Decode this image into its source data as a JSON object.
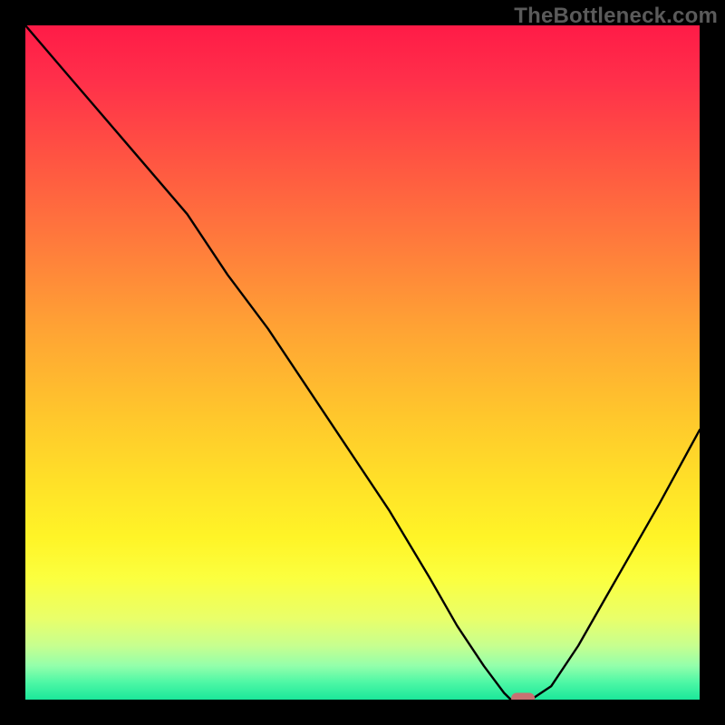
{
  "watermark": "TheBottleneck.com",
  "chart_data": {
    "type": "line",
    "title": "",
    "xlabel": "",
    "ylabel": "",
    "xlim": [
      0,
      100
    ],
    "ylim": [
      0,
      100
    ],
    "grid": false,
    "legend": false,
    "series": [
      {
        "name": "bottleneck-curve",
        "x": [
          0,
          6,
          12,
          18,
          24,
          30,
          36,
          42,
          48,
          54,
          60,
          64,
          68,
          71,
          72,
          75,
          78,
          82,
          86,
          90,
          94,
          100
        ],
        "y": [
          100,
          93,
          86,
          79,
          72,
          63,
          55,
          46,
          37,
          28,
          18,
          11,
          5,
          1,
          0,
          0,
          2,
          8,
          15,
          22,
          29,
          40
        ]
      }
    ],
    "marker": {
      "x": 73.8,
      "y": 0,
      "color": "#c77272"
    },
    "background_gradient": {
      "top": "#ff1b47",
      "bottom": "#1be79a",
      "description": "vertical red-to-green heat gradient"
    }
  }
}
